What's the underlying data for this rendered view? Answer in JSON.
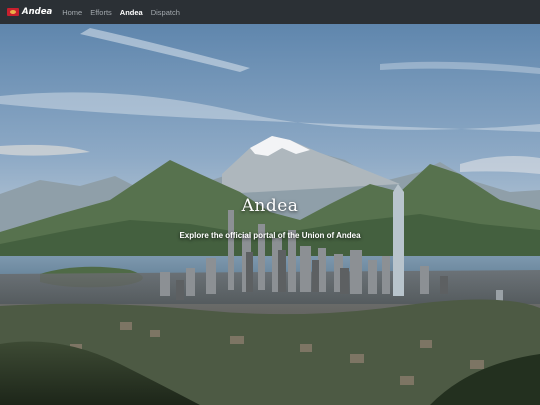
{
  "brand": {
    "name": "Andea"
  },
  "nav": {
    "links": [
      {
        "label": "Home"
      },
      {
        "label": "Efforts"
      },
      {
        "label": "Andea",
        "active": true
      },
      {
        "label": "Dispatch"
      }
    ]
  },
  "hero": {
    "title": "Andea",
    "subtitle": "Explore the official portal of the Union of Andea"
  },
  "colors": {
    "navbar": "#2b3035",
    "flag": "#c8202e",
    "text": "#ffffff",
    "nav_inactive": "#a3a9ae"
  }
}
